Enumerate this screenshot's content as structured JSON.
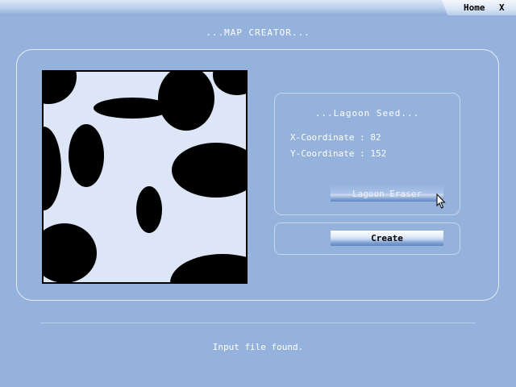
{
  "topbar": {
    "home_label": "Home",
    "close_label": "X"
  },
  "page": {
    "title": "...MAP CREATOR..."
  },
  "map_preview": {
    "fill_color": "#dce6f7",
    "blob_color": "#000000"
  },
  "lagoon_seed": {
    "title": "...Lagoon Seed...",
    "x_coordinate": "X-Coordinate : 82",
    "y_coordinate": "Y-Coordinate : 152",
    "eraser_label": "Lagoon Eraser"
  },
  "actions": {
    "create_label": "Create"
  },
  "status": {
    "message": "Input file found."
  },
  "icons": {
    "cursor": "mouse-pointer-icon"
  }
}
